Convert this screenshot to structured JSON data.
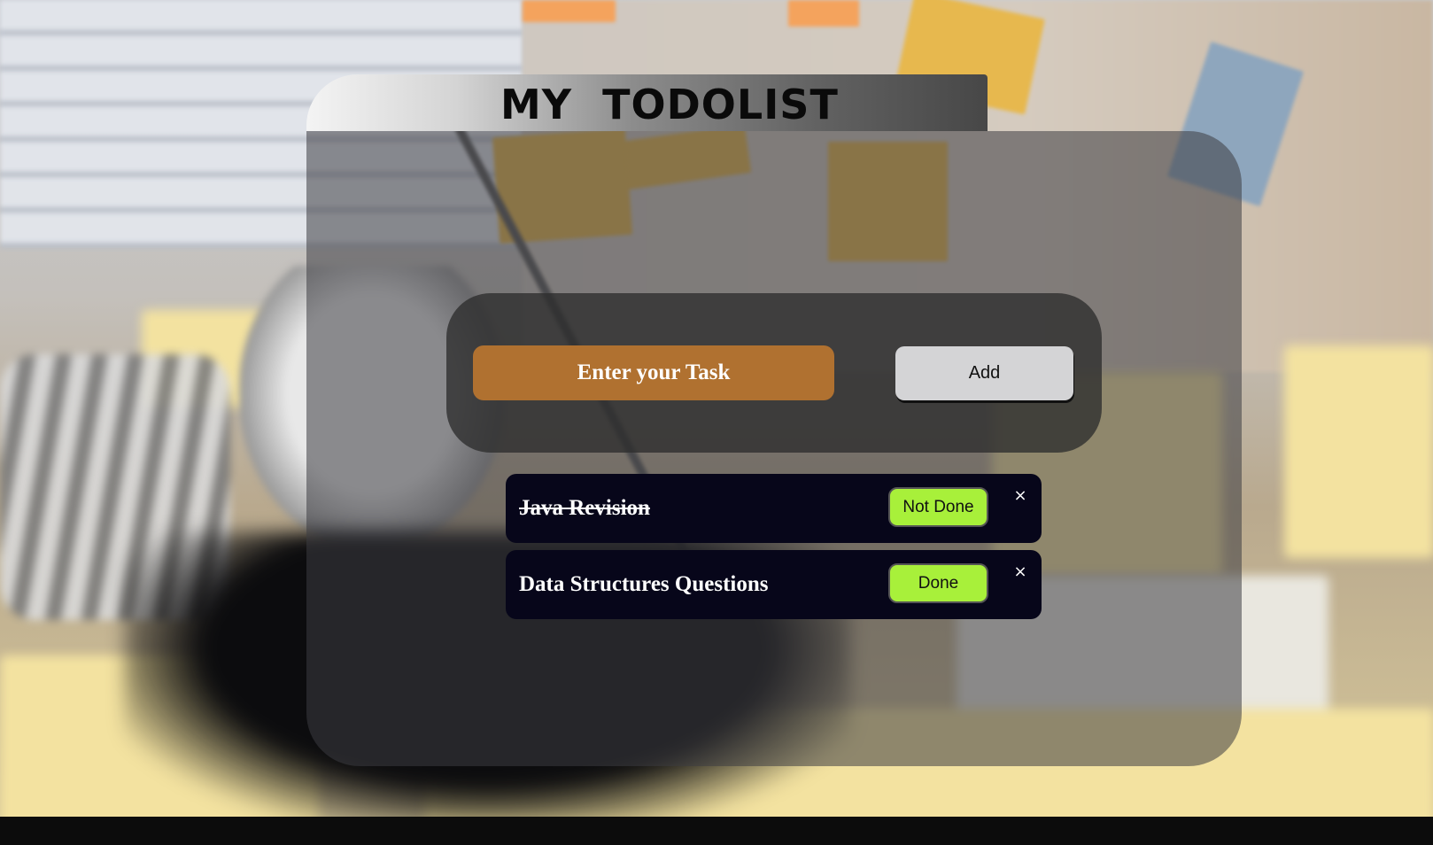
{
  "app": {
    "title": "MY  TODOLIST"
  },
  "input": {
    "placeholder": "Enter your Task",
    "value": ""
  },
  "add_button": {
    "label": "Add"
  },
  "todos": [
    {
      "text": "Java Revision",
      "completed": true,
      "status_button": "Not Done",
      "close": "×"
    },
    {
      "text": "Data Structures Questions",
      "completed": false,
      "status_button": "Done",
      "close": "×"
    }
  ],
  "colors": {
    "input_bg": "#b07130",
    "add_button_bg": "#d4d4d6",
    "status_button_bg": "#a8f03a",
    "todo_bg": "#07061a",
    "panel_bg": "rgba(60,60,65,0.55)"
  }
}
